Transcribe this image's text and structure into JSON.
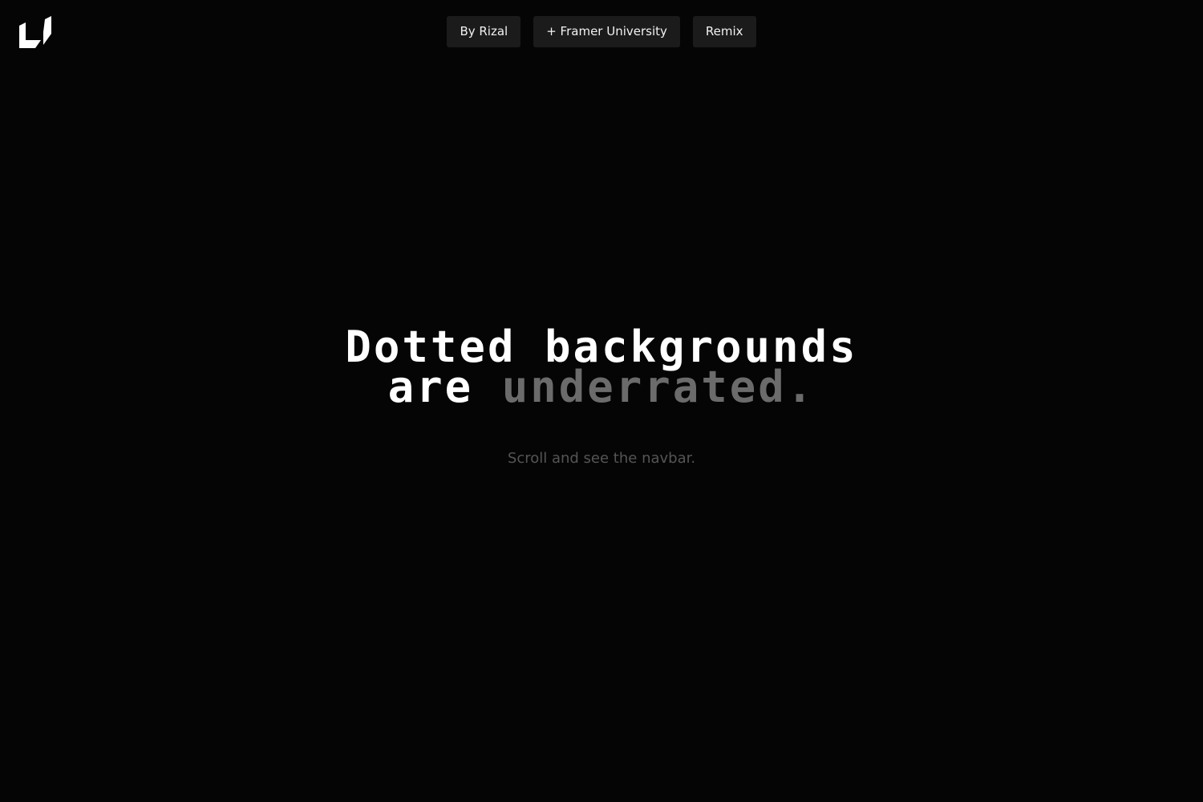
{
  "logo": {
    "icon": "framer-university-logo-icon"
  },
  "nav": {
    "items": [
      {
        "label": "By Rizal"
      },
      {
        "label": "+ Framer University"
      },
      {
        "label": "Remix"
      }
    ]
  },
  "hero": {
    "line1": "Dotted backgrounds",
    "line2_prefix": "are ",
    "line2_highlight": "underrated.",
    "subtext": "Scroll and see the navbar."
  },
  "colors": {
    "background": "#050505",
    "button_bg": "#1b1b1b",
    "headline": "#ffffff",
    "headline_muted": "#6b6b6b",
    "subtext": "#555555"
  }
}
